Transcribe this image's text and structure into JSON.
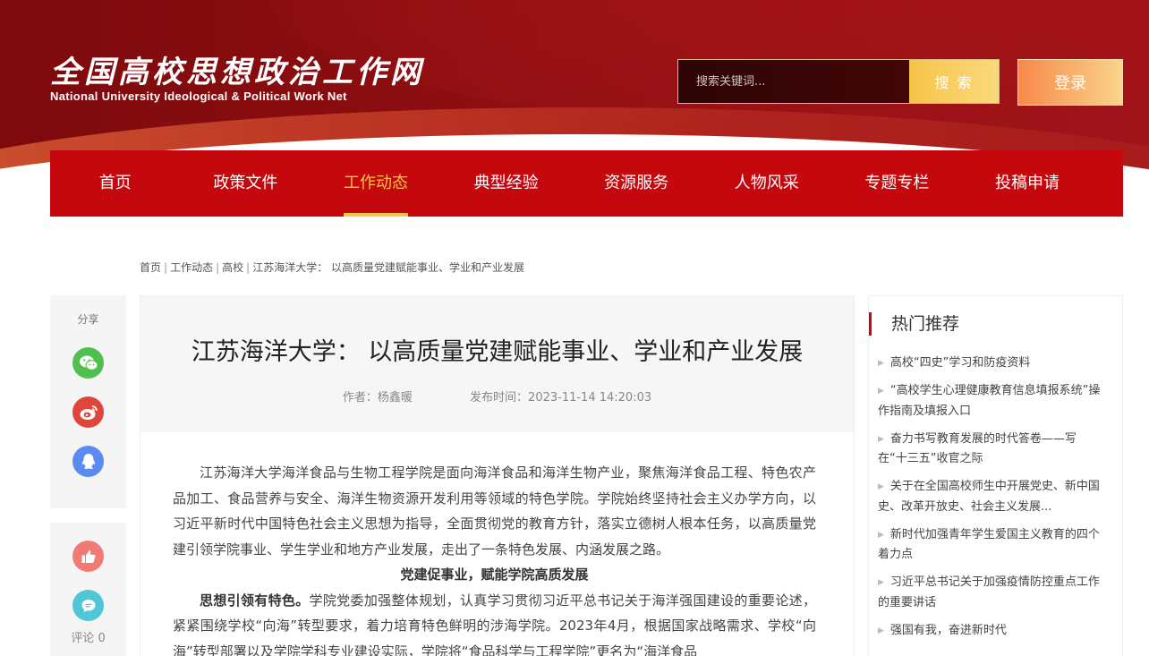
{
  "header": {
    "logo_cn": "全国高校思想政治工作网",
    "logo_en": "National University Ideological & Political Work Net",
    "search_placeholder": "搜索关键词...",
    "search_label": "搜 索",
    "login_label": "登录"
  },
  "nav": {
    "items": [
      "首页",
      "政策文件",
      "工作动态",
      "典型经验",
      "资源服务",
      "人物风采",
      "专题专栏",
      "投稿申请"
    ],
    "active_index": 2
  },
  "breadcrumb": [
    "首页",
    "工作动态",
    "高校",
    "江苏海洋大学： 以高质量党建赋能事业、学业和产业发展"
  ],
  "share": {
    "title": "分享",
    "icons": [
      "wechat-icon",
      "weibo-icon",
      "qq-icon"
    ],
    "comment_label": "评论",
    "comment_count": "0"
  },
  "article": {
    "title": "江苏海洋大学： 以高质量党建赋能事业、学业和产业发展",
    "author_label": "作者：",
    "author": "杨鑫暖",
    "time_label": "发布时间：",
    "time": "2023-11-14 14:20:03",
    "para1": "江苏海洋大学海洋食品与生物工程学院是面向海洋食品和海洋生物产业，聚焦海洋食品工程、特色农产品加工、食品营养与安全、海洋生物资源开发利用等领域的特色学院。学院始终坚持社会主义办学方向，以习近平新时代中国特色社会主义思想为指导，全面贯彻党的教育方针，落实立德树人根本任务，以高质量党建引领学院事业、学生学业和地方产业发展，走出了一条特色发展、内涵发展之路。",
    "subtitle": "党建促事业，赋能学院高质发展",
    "para2_bold": "思想引领有特色。",
    "para2": "学院党委加强整体规划，认真学习贯彻习近平总书记关于海洋强国建设的重要论述，紧紧围绕学校“向海”转型要求，着力培育特色鲜明的涉海学院。2023年4月，根据国家战略需求、学校“向海”转型部署以及学院学科专业建设实际，学院将“食品科学与工程学院”更名为“海洋食品"
  },
  "hot": {
    "title": "热门推荐",
    "items": [
      "高校“四史”学习和防疫资料",
      "“高校学生心理健康教育信息填报系统”操作指南及填报入口",
      "奋力书写教育发展的时代答卷——写在“十三五”收官之际",
      "关于在全国高校师生中开展党史、新中国史、改革开放史、社会主义发展...",
      "新时代加强青年学生爱国主义教育的四个着力点",
      "习近平总书记关于加强疫情防控重点工作的重要讲话",
      "强国有我，奋进新时代"
    ]
  },
  "colors": {
    "nav_red": "#c5080d",
    "active_gold": "#f9c744",
    "header_dark_red": "#7d0a0d"
  }
}
